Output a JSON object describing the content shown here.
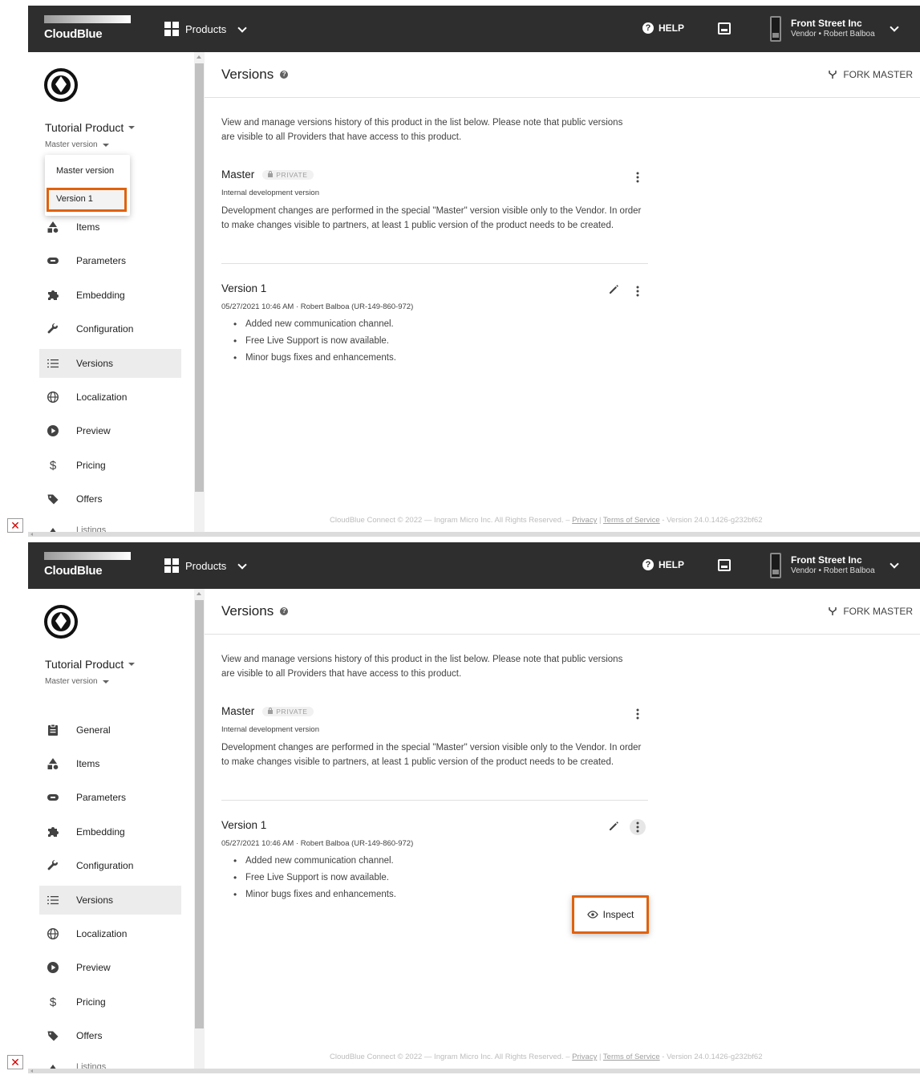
{
  "topbar": {
    "logo": "CloudBlue",
    "products_label": "Products",
    "help_label": "HELP",
    "account_name": "Front Street Inc",
    "account_sub": "Vendor • Robert Balboa"
  },
  "sidebar": {
    "product_title": "Tutorial Product",
    "product_version": "Master version",
    "version_menu": [
      "Master version",
      "Version 1"
    ],
    "nav": {
      "general": "General",
      "items": "Items",
      "parameters": "Parameters",
      "embedding": "Embedding",
      "configuration": "Configuration",
      "versions": "Versions",
      "localization": "Localization",
      "preview": "Preview",
      "pricing": "Pricing",
      "offers": "Offers",
      "listings": "Listings"
    }
  },
  "main": {
    "title": "Versions",
    "fork_label": "FORK MASTER",
    "intro": "View and manage versions history of this product in the list below. Please note that public versions are visible to all Providers that have access to this product.",
    "master": {
      "name": "Master",
      "badge": "PRIVATE",
      "subtitle": "Internal development version",
      "description": "Development changes are performed in the special \"Master\" version visible only to the Vendor. In order to make changes visible to partners, at least 1 public version of the product needs to be created."
    },
    "version1": {
      "name": "Version 1",
      "meta": "05/27/2021 10:46 AM  ·  Robert Balboa (UR-149-860-972)",
      "changes": [
        "Added new communication channel.",
        "Free Live Support is now available.",
        "Minor bugs fixes and enhancements."
      ]
    },
    "inspect_label": "Inspect"
  },
  "footer": {
    "copyright": "CloudBlue Connect © 2022 — Ingram Micro Inc. All Rights Reserved. – ",
    "privacy": "Privacy",
    "divider": " | ",
    "terms": "Terms of Service",
    "version": " - Version 24.0.1426-g232bf62"
  },
  "colors": {
    "topbar": "#2e2e2e",
    "highlight": "#e0620d",
    "active_nav": "#ececec"
  }
}
